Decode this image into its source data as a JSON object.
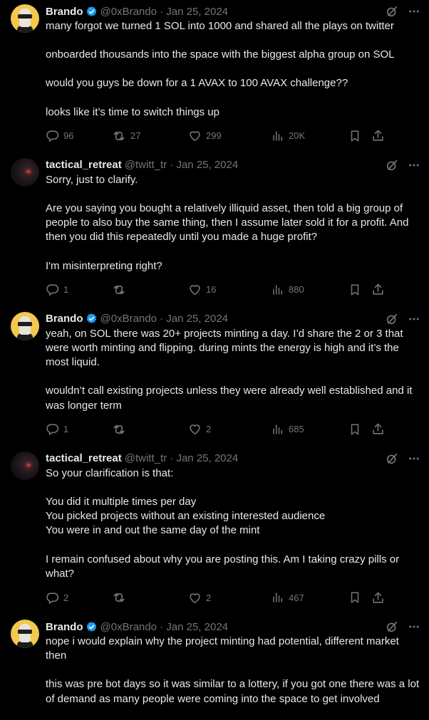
{
  "tweets": [
    {
      "author": "Brando",
      "handle": "@0xBrando · Jan 25, 2024",
      "verified": true,
      "avatar": "brando",
      "paragraphs": [
        "many forgot we turned 1 SOL into 1000 and shared all the plays on twitter",
        "onboarded thousands into the space with the biggest alpha group on SOL",
        "would you guys be down for a 1 AVAX to 100 AVAX challenge??",
        "looks like it’s time to switch things up"
      ],
      "replies": "96",
      "retweets": "27",
      "likes": "299",
      "views": "20K"
    },
    {
      "author": "tactical_retreat",
      "handle": "@twitt_tr · Jan 25, 2024",
      "verified": false,
      "avatar": "tactical",
      "paragraphs": [
        "Sorry, just to clarify.",
        "Are you saying you bought a relatively illiquid asset, then told a big group of people to also buy the same thing, then I assume later sold it for a profit. And then you did this repeatedly until you made a huge profit?",
        "I'm misinterpreting right?"
      ],
      "replies": "1",
      "retweets": "",
      "likes": "16",
      "views": "880"
    },
    {
      "author": "Brando",
      "handle": "@0xBrando · Jan 25, 2024",
      "verified": true,
      "avatar": "brando",
      "paragraphs": [
        "yeah, on SOL there was 20+ projects minting a day. I’d share the 2 or 3 that were worth minting and flipping. during mints the energy is high and it’s the most liquid.",
        "wouldn’t call existing projects unless they were already well established and it was longer term"
      ],
      "replies": "1",
      "retweets": "",
      "likes": "2",
      "views": "685"
    },
    {
      "author": "tactical_retreat",
      "handle": "@twitt_tr · Jan 25, 2024",
      "verified": false,
      "avatar": "tactical",
      "paragraphs": [
        "So your clarification is that:",
        "You did it multiple times per day\nYou picked projects without an existing interested audience\nYou were in and out the same day of the mint",
        "I remain confused about why you are posting this. Am I taking crazy pills or what?"
      ],
      "replies": "2",
      "retweets": "",
      "likes": "2",
      "views": "467"
    },
    {
      "author": "Brando",
      "handle": "@0xBrando · Jan 25, 2024",
      "verified": true,
      "avatar": "brando",
      "paragraphs": [
        "nope i would explain why the project minting had potential, different market then",
        "this was pre bot days so it was similar to a lottery, if you got one there was a lot of demand as many people were coming into the space to get involved"
      ],
      "replies": "",
      "retweets": "",
      "likes": "",
      "views": ""
    }
  ],
  "icons": {
    "verified": "verified-badge-icon",
    "grok": "grok-icon",
    "more": "more-icon",
    "reply": "reply-icon",
    "retweet": "retweet-icon",
    "like": "like-icon",
    "views": "views-icon",
    "bookmark": "bookmark-icon",
    "share": "share-icon"
  },
  "colors": {
    "background": "#000000",
    "text": "#e7e9ea",
    "muted": "#71767b",
    "verified": "#1d9bf0",
    "thread_line": "#333639"
  }
}
